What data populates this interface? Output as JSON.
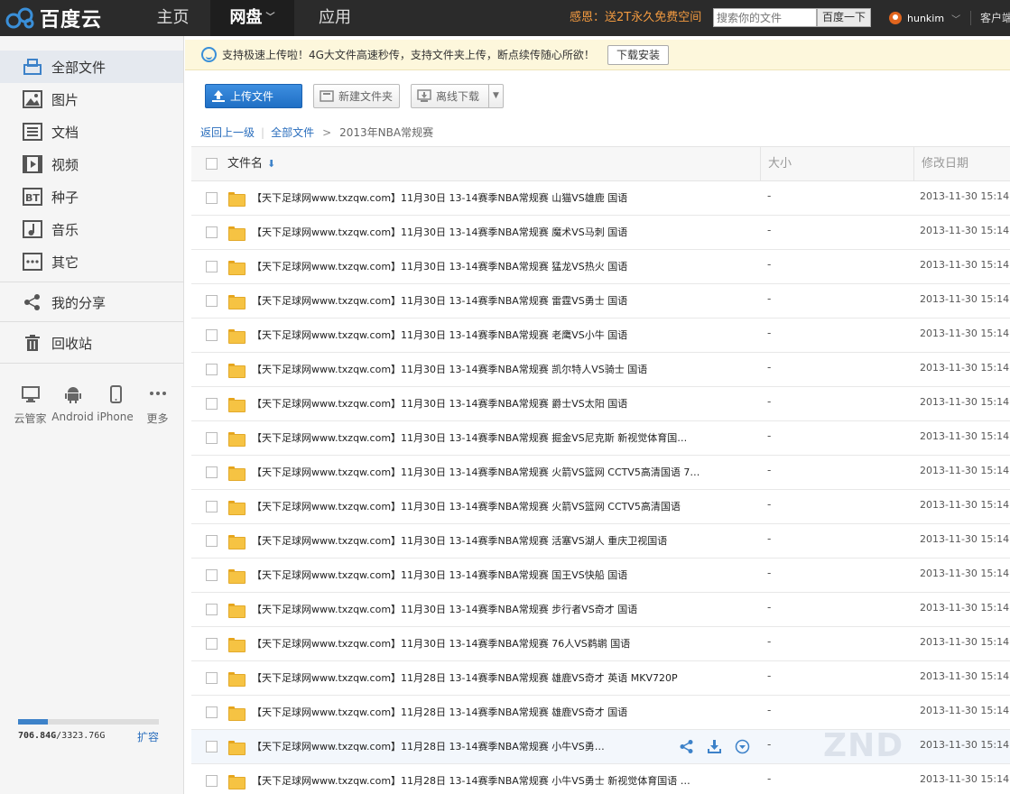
{
  "topnav": {
    "logo_text": "百度云",
    "tabs": [
      {
        "label": "主页"
      },
      {
        "label": "网盘"
      },
      {
        "label": "应用"
      }
    ],
    "promo": "感恩：送2T永久免费空间",
    "search_placeholder": "搜索你的文件",
    "search_button": "百度一下",
    "username": "hunkim",
    "client_label": "客户端"
  },
  "sidebar": {
    "items": [
      {
        "label": "全部文件",
        "icon": "all-files-icon"
      },
      {
        "label": "图片",
        "icon": "image-icon"
      },
      {
        "label": "文档",
        "icon": "document-icon"
      },
      {
        "label": "视频",
        "icon": "video-icon"
      },
      {
        "label": "种子",
        "icon": "bt-icon"
      },
      {
        "label": "音乐",
        "icon": "music-icon"
      },
      {
        "label": "其它",
        "icon": "other-icon"
      },
      {
        "label": "我的分享",
        "icon": "share-icon"
      },
      {
        "label": "回收站",
        "icon": "trash-icon"
      }
    ],
    "devices": [
      {
        "label": "云管家",
        "icon": "monitor-icon"
      },
      {
        "label": "Android",
        "icon": "android-icon"
      },
      {
        "label": "iPhone",
        "icon": "phone-icon"
      },
      {
        "label": "更多",
        "icon": "more-icon"
      }
    ],
    "quota": {
      "used": "706.84G",
      "total": "/3323.76G",
      "fraction": 0.21
    },
    "expand_label": "扩容"
  },
  "notice": {
    "text": "支持极速上传啦！4G大文件高速秒传，支持文件夹上传，断点续传随心所欲！",
    "button": "下载安装"
  },
  "toolbar": {
    "upload": "上传文件",
    "new_folder": "新建文件夹",
    "offline": "离线下载"
  },
  "breadcrumb": {
    "back": "返回上一级",
    "all": "全部文件",
    "current": "2013年NBA常规赛"
  },
  "table": {
    "col_name": "文件名",
    "col_size": "大小",
    "col_date": "修改日期",
    "rows": [
      {
        "name": "【天下足球网www.txzqw.com】11月30日 13-14赛季NBA常规赛 山猫VS雄鹿 国语",
        "size": "-",
        "date": "2013-11-30 15:14"
      },
      {
        "name": "【天下足球网www.txzqw.com】11月30日 13-14赛季NBA常规赛 魔术VS马刺 国语",
        "size": "-",
        "date": "2013-11-30 15:14"
      },
      {
        "name": "【天下足球网www.txzqw.com】11月30日 13-14赛季NBA常规赛 猛龙VS热火 国语",
        "size": "-",
        "date": "2013-11-30 15:14"
      },
      {
        "name": "【天下足球网www.txzqw.com】11月30日 13-14赛季NBA常规赛 雷霆VS勇士 国语",
        "size": "-",
        "date": "2013-11-30 15:14"
      },
      {
        "name": "【天下足球网www.txzqw.com】11月30日 13-14赛季NBA常规赛 老鹰VS小牛 国语",
        "size": "-",
        "date": "2013-11-30 15:14"
      },
      {
        "name": "【天下足球网www.txzqw.com】11月30日 13-14赛季NBA常规赛 凯尔特人VS骑士 国语",
        "size": "-",
        "date": "2013-11-30 15:14"
      },
      {
        "name": "【天下足球网www.txzqw.com】11月30日 13-14赛季NBA常规赛 爵士VS太阳 国语",
        "size": "-",
        "date": "2013-11-30 15:14"
      },
      {
        "name": "【天下足球网www.txzqw.com】11月30日 13-14赛季NBA常规赛 掘金VS尼克斯 新视觉体育国…",
        "size": "-",
        "date": "2013-11-30 15:14"
      },
      {
        "name": "【天下足球网www.txzqw.com】11月30日 13-14赛季NBA常规赛 火箭VS篮网 CCTV5高清国语 7…",
        "size": "-",
        "date": "2013-11-30 15:14"
      },
      {
        "name": "【天下足球网www.txzqw.com】11月30日 13-14赛季NBA常规赛 火箭VS篮网 CCTV5高清国语",
        "size": "-",
        "date": "2013-11-30 15:14"
      },
      {
        "name": "【天下足球网www.txzqw.com】11月30日 13-14赛季NBA常规赛 活塞VS湖人 重庆卫视国语",
        "size": "-",
        "date": "2013-11-30 15:14"
      },
      {
        "name": "【天下足球网www.txzqw.com】11月30日 13-14赛季NBA常规赛 国王VS快船 国语",
        "size": "-",
        "date": "2013-11-30 15:14"
      },
      {
        "name": "【天下足球网www.txzqw.com】11月30日 13-14赛季NBA常规赛 步行者VS奇才 国语",
        "size": "-",
        "date": "2013-11-30 15:14"
      },
      {
        "name": "【天下足球网www.txzqw.com】11月30日 13-14赛季NBA常规赛 76人VS鹈鹕 国语",
        "size": "-",
        "date": "2013-11-30 15:14"
      },
      {
        "name": "【天下足球网www.txzqw.com】11月28日 13-14赛季NBA常规赛 雄鹿VS奇才 英语 MKV720P",
        "size": "-",
        "date": "2013-11-30 15:14"
      },
      {
        "name": "【天下足球网www.txzqw.com】11月28日 13-14赛季NBA常规赛 雄鹿VS奇才 国语",
        "size": "-",
        "date": "2013-11-30 15:14"
      },
      {
        "name": "【天下足球网www.txzqw.com】11月28日 13-14赛季NBA常规赛 小牛VS勇…",
        "size": "-",
        "date": "2013-11-30 15:14"
      },
      {
        "name": "【天下足球网www.txzqw.com】11月28日 13-14赛季NBA常规赛 小牛VS勇士 新视觉体育国语 …",
        "size": "-",
        "date": "2013-11-30 15:14"
      }
    ],
    "hover_row": 16
  },
  "colors": {
    "topnav_bg": "#2b2b2b",
    "accent": "#3d82c9",
    "promo": "#f29a40",
    "folder": "#f6c343"
  }
}
